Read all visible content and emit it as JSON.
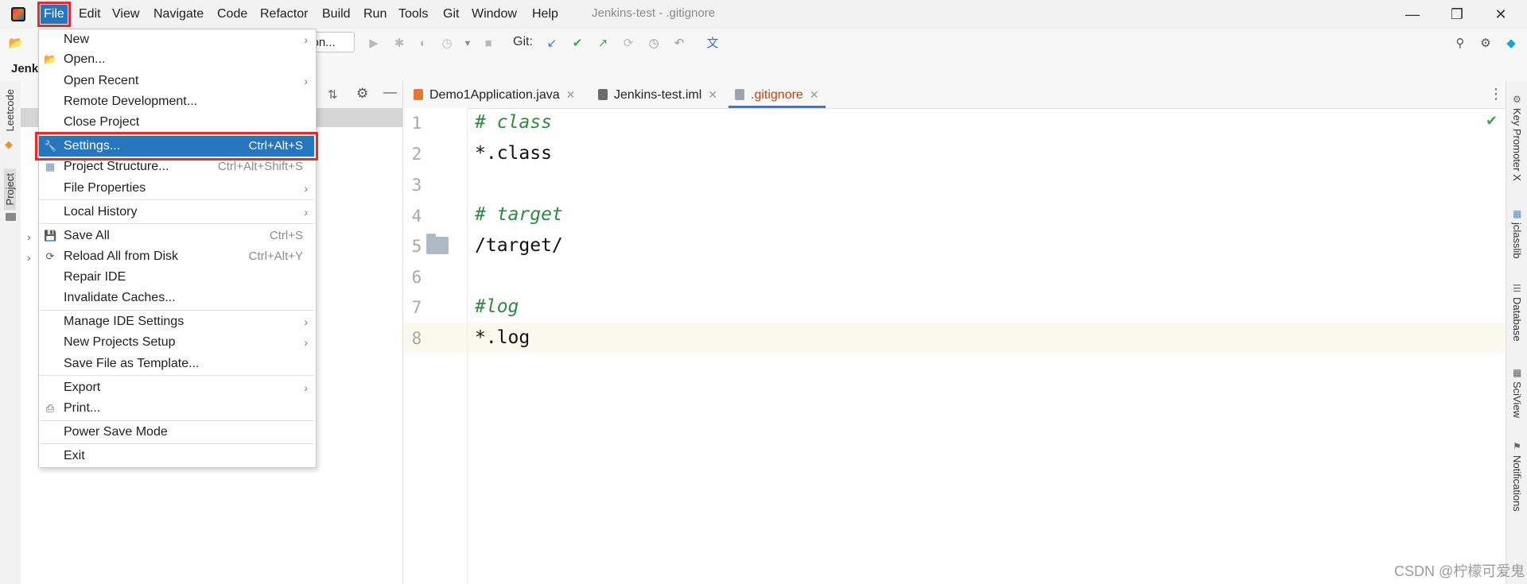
{
  "menubar": {
    "items": [
      "File",
      "Edit",
      "View",
      "Navigate",
      "Code",
      "Refactor",
      "Build",
      "Run",
      "Tools",
      "Git",
      "Window",
      "Help"
    ]
  },
  "window_title": "Jenkins-test - .gitignore",
  "toolbar": {
    "run_config_label": "tion...",
    "git_label": "Git:"
  },
  "breadcrumb": "Jenk",
  "left_tool_tabs": [
    "Leetcode",
    "Project"
  ],
  "right_tool_tabs": [
    "Key Promoter X",
    "jclasslib",
    "Database",
    "SciView",
    "Notifications"
  ],
  "editor_tabs": [
    {
      "label": "Demo1Application.java",
      "selected": false
    },
    {
      "label": "Jenkins-test.iml",
      "selected": false
    },
    {
      "label": ".gitignore",
      "selected": true
    }
  ],
  "editor": {
    "lines": [
      {
        "num": "1",
        "text": "# class",
        "type": "comment"
      },
      {
        "num": "2",
        "text": "*.class",
        "type": "code"
      },
      {
        "num": "3",
        "text": "",
        "type": "code"
      },
      {
        "num": "4",
        "text": "# target",
        "type": "comment"
      },
      {
        "num": "5",
        "text": "/target/",
        "type": "code"
      },
      {
        "num": "6",
        "text": "",
        "type": "code"
      },
      {
        "num": "7",
        "text": "#log",
        "type": "comment"
      },
      {
        "num": "8",
        "text": "*.log",
        "type": "code"
      }
    ]
  },
  "file_menu": {
    "items": [
      {
        "label": "New",
        "shortcut": "",
        "submenu": true,
        "icon": ""
      },
      {
        "label": "Open...",
        "shortcut": "",
        "submenu": false,
        "icon": "folder-icon"
      },
      {
        "label": "Open Recent",
        "shortcut": "",
        "submenu": true,
        "icon": ""
      },
      {
        "label": "Remote Development...",
        "shortcut": "",
        "submenu": false,
        "icon": ""
      },
      {
        "label": "Close Project",
        "shortcut": "",
        "submenu": false,
        "icon": ""
      },
      {
        "label": "Settings...",
        "shortcut": "Ctrl+Alt+S",
        "submenu": false,
        "icon": "wrench-icon",
        "selected": true
      },
      {
        "label": "Project Structure...",
        "shortcut": "Ctrl+Alt+Shift+S",
        "submenu": false,
        "icon": "project-structure-icon"
      },
      {
        "label": "File Properties",
        "shortcut": "",
        "submenu": true,
        "icon": ""
      },
      {
        "label": "Local History",
        "shortcut": "",
        "submenu": true,
        "icon": ""
      },
      {
        "label": "Save All",
        "shortcut": "Ctrl+S",
        "submenu": false,
        "icon": "save-icon"
      },
      {
        "label": "Reload All from Disk",
        "shortcut": "Ctrl+Alt+Y",
        "submenu": false,
        "icon": "reload-icon"
      },
      {
        "label": "Repair IDE",
        "shortcut": "",
        "submenu": false,
        "icon": ""
      },
      {
        "label": "Invalidate Caches...",
        "shortcut": "",
        "submenu": false,
        "icon": ""
      },
      {
        "label": "Manage IDE Settings",
        "shortcut": "",
        "submenu": true,
        "icon": ""
      },
      {
        "label": "New Projects Setup",
        "shortcut": "",
        "submenu": true,
        "icon": ""
      },
      {
        "label": "Save File as Template...",
        "shortcut": "",
        "submenu": false,
        "icon": ""
      },
      {
        "label": "Export",
        "shortcut": "",
        "submenu": true,
        "icon": ""
      },
      {
        "label": "Print...",
        "shortcut": "",
        "submenu": false,
        "icon": "print-icon"
      },
      {
        "label": "Power Save Mode",
        "shortcut": "",
        "submenu": false,
        "icon": ""
      },
      {
        "label": "Exit",
        "shortcut": "",
        "submenu": false,
        "icon": ""
      }
    ]
  },
  "watermark": "CSDN @柠檬可爱鬼"
}
